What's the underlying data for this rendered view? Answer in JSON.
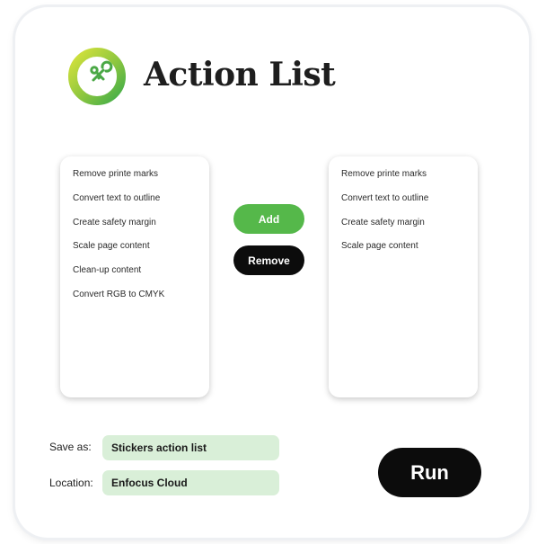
{
  "header": {
    "title": "Action List",
    "logo_icon": "wrench-key-icon"
  },
  "available_actions": {
    "items": [
      "Remove printe marks",
      "Convert text to outline",
      "Create safety margin",
      "Scale page content",
      "Clean-up content",
      "Convert RGB to CMYK"
    ]
  },
  "selected_actions": {
    "items": [
      "Remove printe marks",
      "Convert text to outline",
      "Create safety margin",
      "Scale page content"
    ]
  },
  "buttons": {
    "add_label": "Add",
    "remove_label": "Remove",
    "run_label": "Run"
  },
  "form": {
    "save_as_label": "Save as:",
    "save_as_value": "Stickers action list",
    "location_label": "Location:",
    "location_value": "Enfocus Cloud"
  },
  "colors": {
    "accent_green": "#55b84a",
    "logo_yellow": "#d6e23a",
    "field_bg": "#d9efd8",
    "button_dark": "#0c0c0c"
  }
}
